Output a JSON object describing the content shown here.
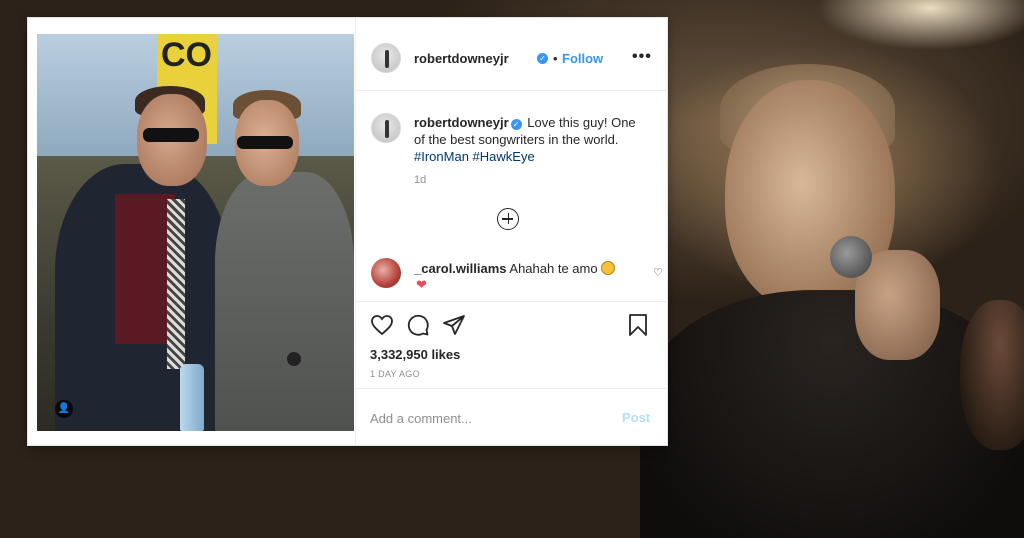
{
  "post": {
    "username": "robertdowneyjr",
    "verified_symbol": "✓",
    "dot": "•",
    "follow_label": "Follow",
    "more_label": "•••",
    "caption_text": "Love this guy! One of the best songwriters in the world.",
    "hashtags": [
      "#IronMan",
      "#HawkEye"
    ],
    "posted_short": "1d",
    "likes": "3,332,950 likes",
    "posted_long": "1 DAY AGO",
    "photo_banner_text": "CO",
    "user_tag_symbol": "👤"
  },
  "comment": {
    "username": "_carol.williams",
    "text": "Ahahah te amo",
    "heart": "♡",
    "red_heart": "❤"
  },
  "composer": {
    "placeholder": "Add a comment...",
    "post_label": "Post"
  },
  "icons": {
    "like": "heart-icon",
    "comment": "comment-bubble-icon",
    "share": "paper-plane-icon",
    "save": "bookmark-icon",
    "load_more": "plus-circle-icon"
  },
  "colors": {
    "accent": "#3897f0",
    "hashtag": "#00376b",
    "muted": "#8e8e8e",
    "like_red": "#ed4956"
  }
}
